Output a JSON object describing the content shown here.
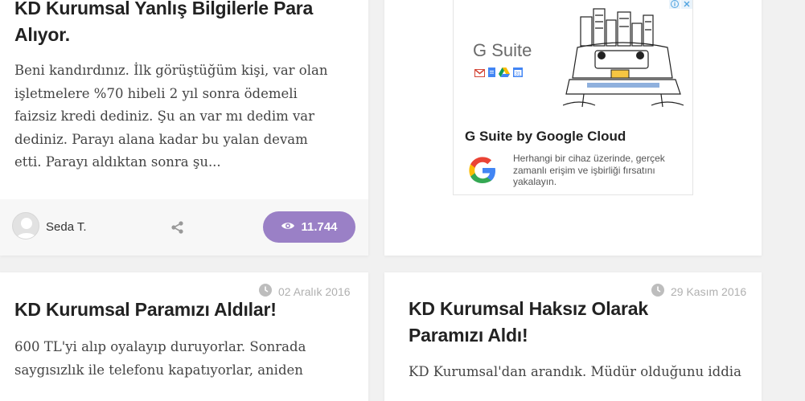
{
  "posts": [
    {
      "title": "KD Kurumsal Yanlış Bilgilerle Para Alıyor.",
      "excerpt": "Beni kandırdınız. İlk görüştüğüm kişi, var olan işletmelere %70 hibeli 2 yıl sonra ödemeli faizsiz kredi dediniz. Şu an var mı dedim var dediniz. Parayı alana kadar bu yalan devam etti. Parayı aldıktan sonra şu...",
      "author": "Seda T.",
      "views": "11.744"
    },
    {
      "date": "02 Aralık 2016",
      "title": "KD Kurumsal Paramızı Aldılar!",
      "excerpt": "600 TL'yi alıp oyalayıp duruyorlar. Sonrada saygısızlık ile telefonu kapatıyorlar, aniden"
    },
    {
      "date": "29 Kasım 2016",
      "title": "KD Kurumsal Haksız Olarak Paramızı Aldı!",
      "excerpt": "KD Kurumsal'dan arandık. Müdür olduğunu iddia"
    }
  ],
  "ad": {
    "brand": "G Suite",
    "title": "G Suite by Google Cloud",
    "description": "Herhangi bir cihaz üzerinde, gerçek zamanlı erişim ve işbirliği fırsatını yakalayın.",
    "icons": [
      "info-icon",
      "close-icon",
      "gmail-icon",
      "docs-icon",
      "drive-icon",
      "calendar-icon",
      "google-g-icon"
    ]
  },
  "colors": {
    "background": "#f1f1f1",
    "views_badge": "#9a80c6",
    "title": "#222222",
    "date": "#b0b0b0",
    "ad_choices": "#4fa3e0"
  }
}
